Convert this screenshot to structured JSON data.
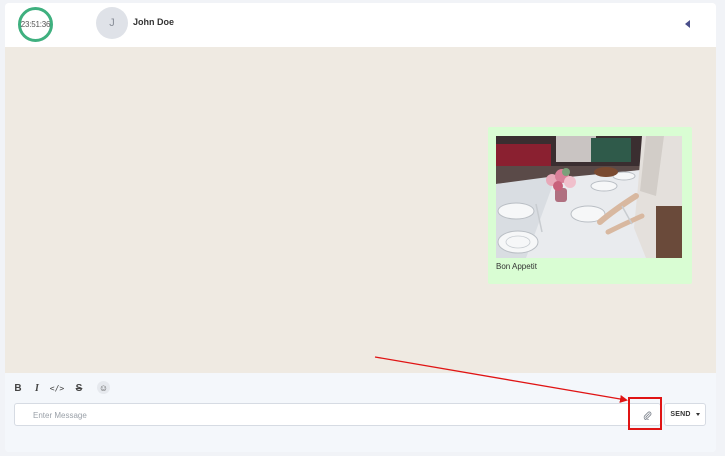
{
  "header": {
    "timer": "23:51:36",
    "avatar_initial": "J",
    "contact_name": "John Doe",
    "collapse_icon": "caret-left-icon"
  },
  "message": {
    "image_alt": "photo of table setting with flowers",
    "caption": "Bon Appetit"
  },
  "composer": {
    "format_buttons": [
      {
        "label": "B",
        "icon": "bold-icon"
      },
      {
        "label": "I",
        "icon": "italic-icon"
      },
      {
        "label": "</>",
        "icon": "code-icon"
      },
      {
        "label": "S",
        "icon": "strikethrough-icon"
      }
    ],
    "emoji_icon": "smiley-icon",
    "emoji_glyph": "☺",
    "input_placeholder": "Enter Message",
    "input_value": "",
    "attach_icon": "paperclip-icon",
    "send_label": "SEND"
  },
  "colors": {
    "accent_green": "#3fb07f",
    "bubble_green": "#d9fdd3",
    "chat_background": "#efeae2",
    "annotation_red": "#e01414"
  }
}
